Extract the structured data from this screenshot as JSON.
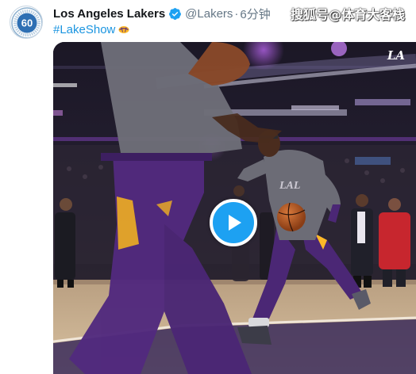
{
  "tweet": {
    "display_name": "Los Angeles Lakers",
    "handle": "@Lakers",
    "separator": "·",
    "time": "6分钟",
    "hashtag": "#LakeShow",
    "avatar_text": "60",
    "verified_icon": "verified-badge-icon",
    "hashtag_emoji": "basketball-emoji-icon"
  },
  "watermark": {
    "text": "搜狐号@体育大客栈"
  },
  "media": {
    "play_icon": "play-icon",
    "corner_logo": "LA",
    "colors": {
      "lakers_purple": "#552583",
      "lakers_gold": "#fdb927",
      "play_blue": "#1da1f2"
    }
  }
}
